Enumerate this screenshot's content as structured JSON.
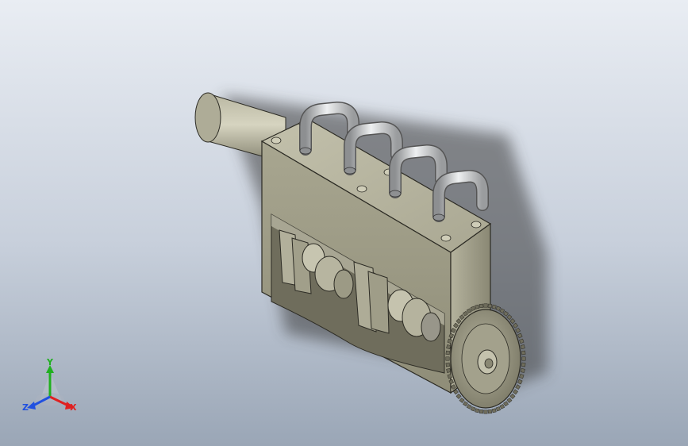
{
  "viewport": {
    "background_top": "#e9edf3",
    "background_bottom": "#9aa6b6"
  },
  "model": {
    "body_color": "#9c9a84",
    "pipe_color": "#c9cbcc",
    "gear_color": "#8e8c7a"
  },
  "triad": {
    "x_label": "X",
    "y_label": "Y",
    "z_label": "Z",
    "x_color": "#e02020",
    "y_color": "#20b020",
    "z_color": "#2050e0"
  }
}
